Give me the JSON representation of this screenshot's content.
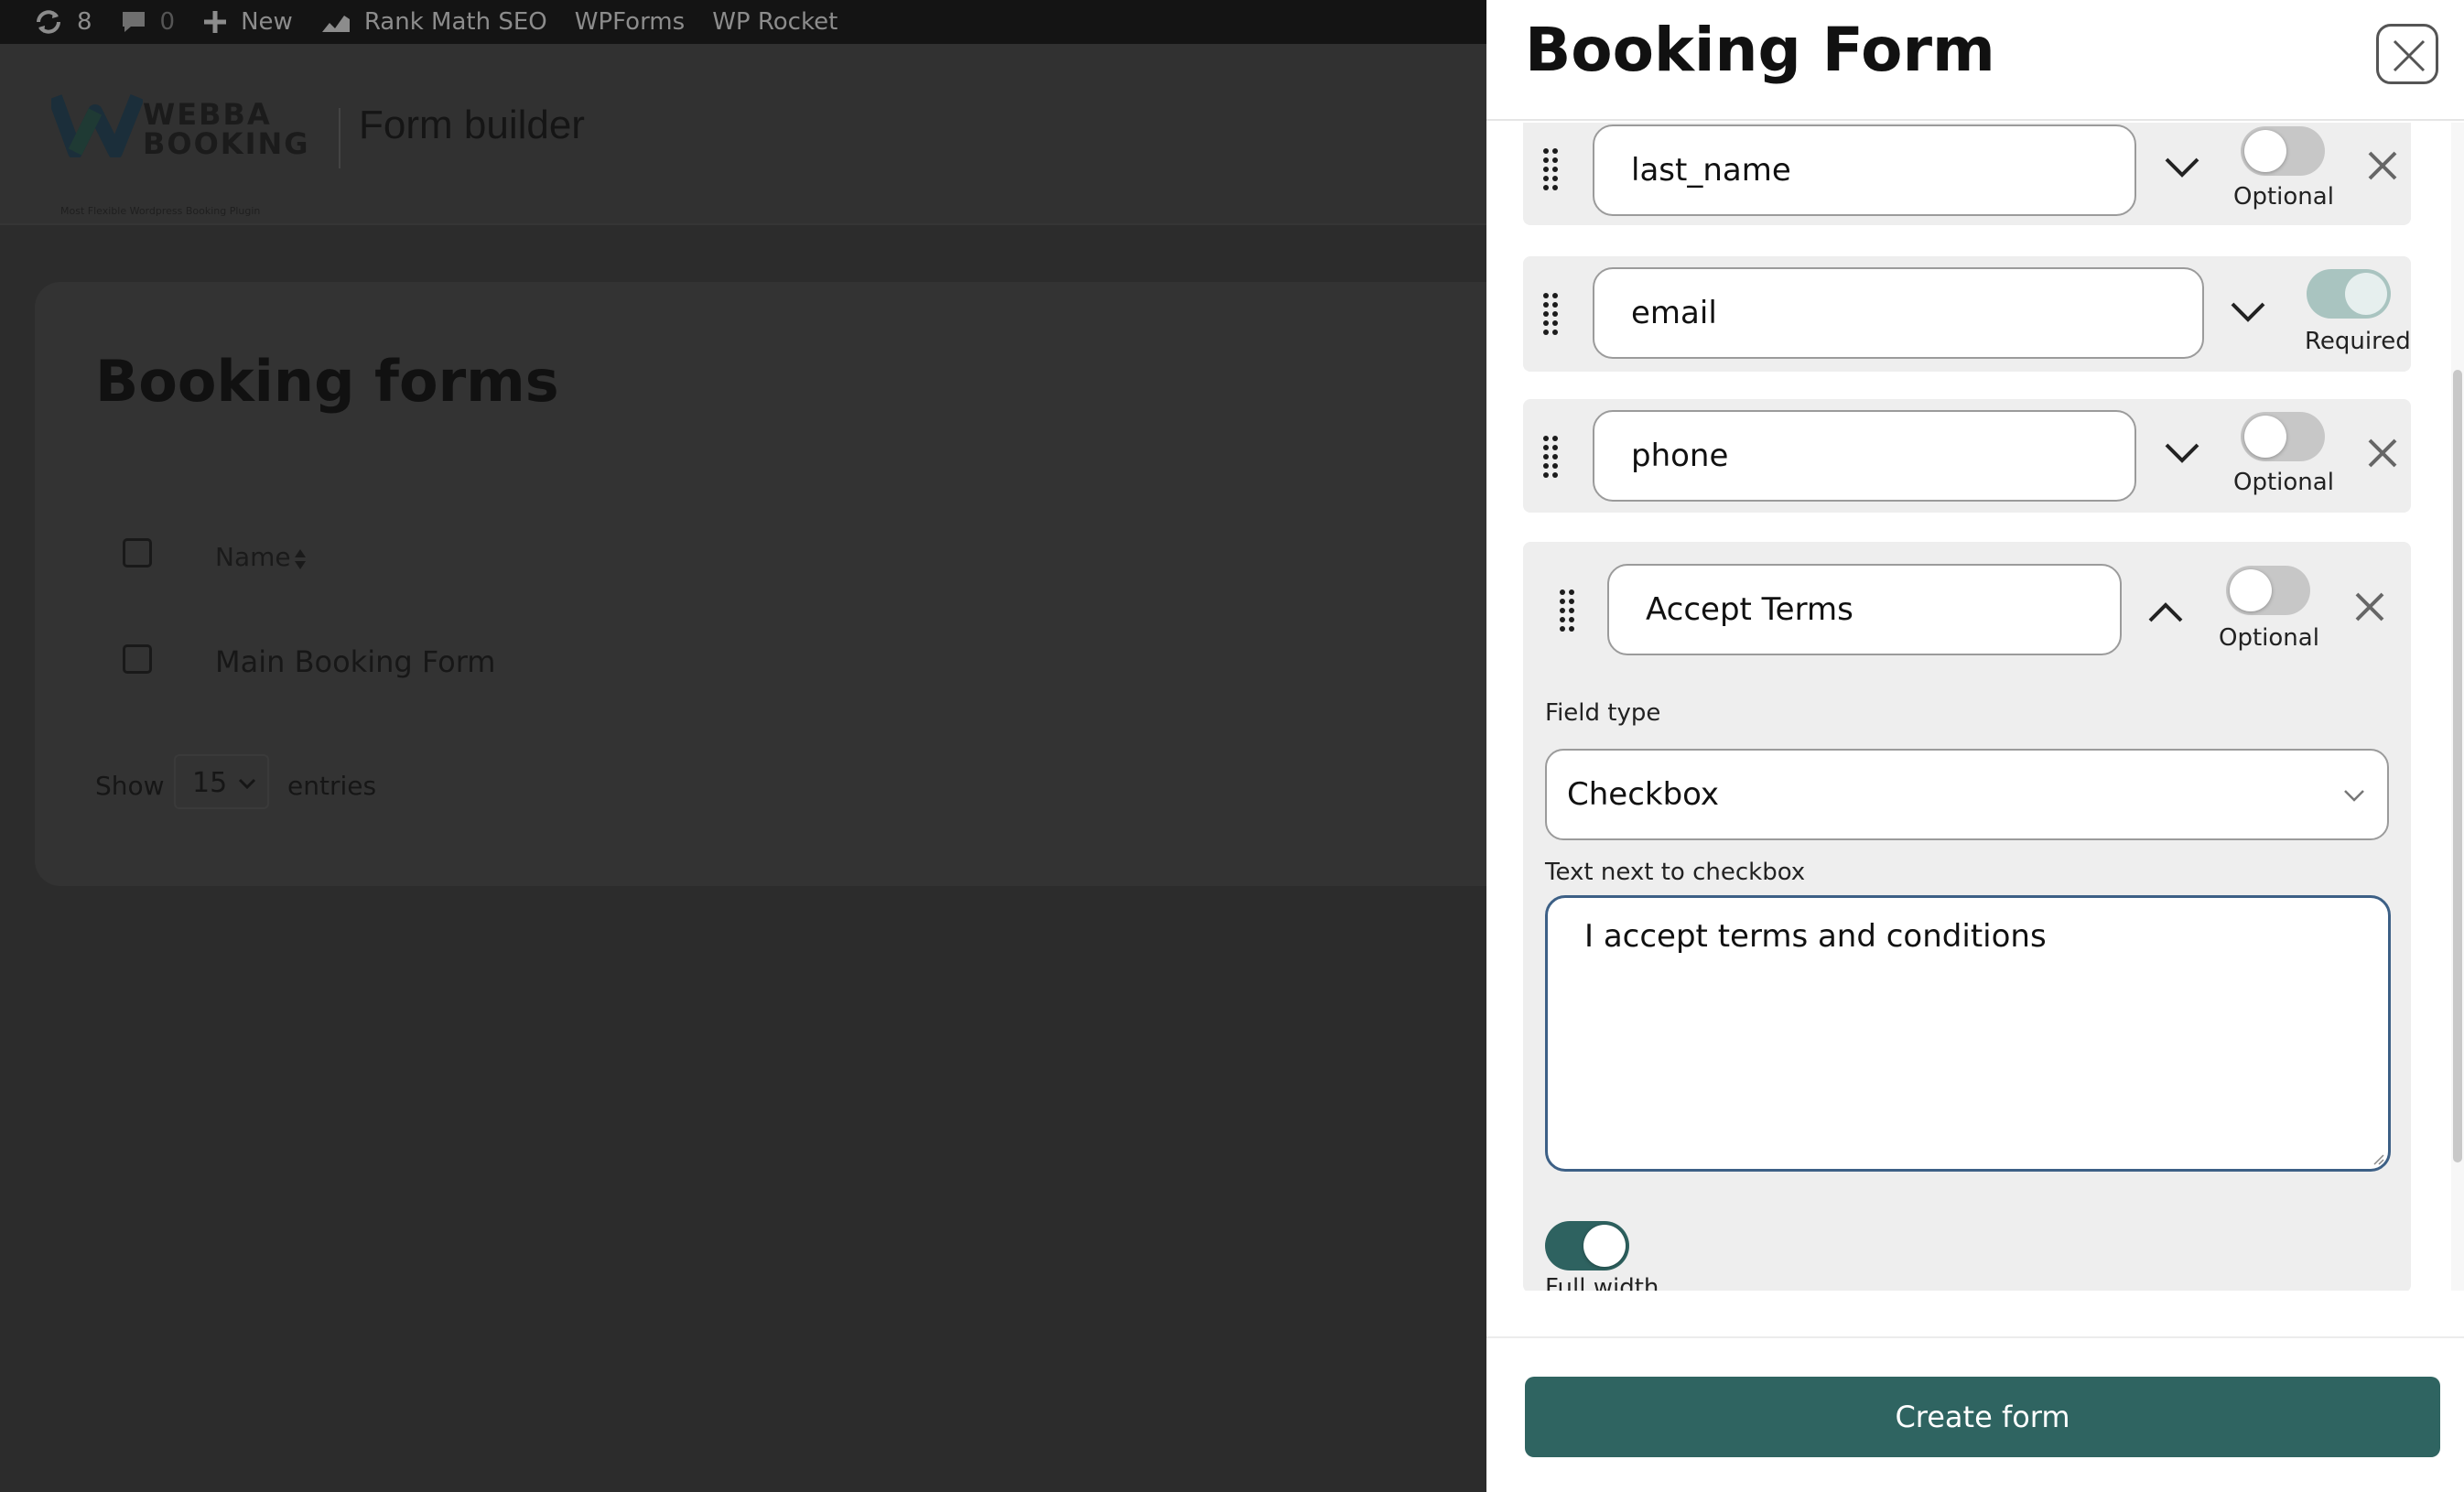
{
  "adminbar": {
    "updates_count": "8",
    "comments_count": "0",
    "new_label": "New",
    "items": [
      "Rank Math SEO",
      "WPForms",
      "WP Rocket"
    ]
  },
  "logo": {
    "line1": "WEBBA",
    "line2": "BOOKING",
    "tagline": "Most Flexible Wordpress Booking Plugin"
  },
  "page": {
    "header_title": "Form builder",
    "card_title": "Booking forms",
    "column_name": "Name",
    "rows": [
      "Main Booking Form"
    ],
    "show_label": "Show",
    "entries_value": "15",
    "entries_label": "entries"
  },
  "panel": {
    "title": "Booking Form",
    "fields": [
      {
        "name": "last_name",
        "status": "Optional",
        "expanded": false
      },
      {
        "name": "email",
        "status": "Required",
        "expanded": false
      },
      {
        "name": "phone",
        "status": "Optional",
        "expanded": false
      },
      {
        "name": "Accept Terms",
        "status": "Optional",
        "expanded": true
      }
    ],
    "expanded_field": {
      "field_type_label": "Field type",
      "field_type_value": "Checkbox",
      "text_label": "Text next to checkbox",
      "text_value": "I accept terms and conditions",
      "full_width_label": "Full width",
      "full_width_on": true
    },
    "create_button": "Create form"
  },
  "colors": {
    "accent": "#2f6461",
    "toggle_required": "#a9c4c0",
    "overlay_page": "#2f2f2f"
  }
}
